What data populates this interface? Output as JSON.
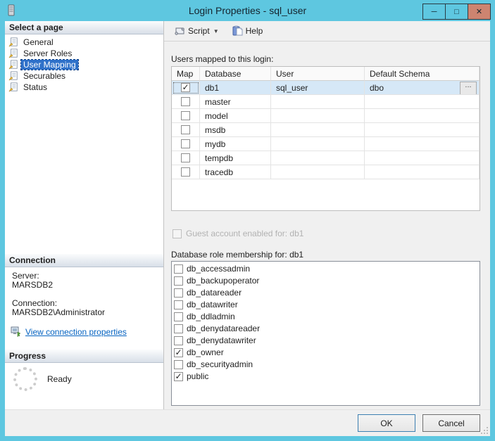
{
  "window": {
    "title": "Login Properties - sql_user",
    "controls": {
      "minimize_glyph": "─",
      "maximize_glyph": "□",
      "close_glyph": "✕"
    }
  },
  "sidebar": {
    "select_page": {
      "header": "Select a page",
      "items": [
        {
          "label": "General",
          "selected": false
        },
        {
          "label": "Server Roles",
          "selected": false
        },
        {
          "label": "User Mapping",
          "selected": true
        },
        {
          "label": "Securables",
          "selected": false
        },
        {
          "label": "Status",
          "selected": false
        }
      ]
    },
    "connection": {
      "header": "Connection",
      "server_label": "Server:",
      "server_value": "MARSDB2",
      "connection_label": "Connection:",
      "connection_value": "MARSDB2\\Administrator",
      "link_label": "View connection properties"
    },
    "progress": {
      "header": "Progress",
      "status": "Ready"
    }
  },
  "toolbar": {
    "script_label": "Script",
    "help_label": "Help"
  },
  "main": {
    "users_mapped_label": "Users mapped to this login:",
    "table": {
      "columns": [
        "Map",
        "Database",
        "User",
        "Default Schema"
      ],
      "rows": [
        {
          "map": true,
          "database": "db1",
          "user": "sql_user",
          "default_schema": "dbo",
          "selected": true
        },
        {
          "map": false,
          "database": "master",
          "user": "",
          "default_schema": "",
          "selected": false
        },
        {
          "map": false,
          "database": "model",
          "user": "",
          "default_schema": "",
          "selected": false
        },
        {
          "map": false,
          "database": "msdb",
          "user": "",
          "default_schema": "",
          "selected": false
        },
        {
          "map": false,
          "database": "mydb",
          "user": "",
          "default_schema": "",
          "selected": false
        },
        {
          "map": false,
          "database": "tempdb",
          "user": "",
          "default_schema": "",
          "selected": false
        },
        {
          "map": false,
          "database": "tracedb",
          "user": "",
          "default_schema": "",
          "selected": false
        }
      ]
    },
    "guest_label": "Guest account enabled for: db1",
    "guest_checked": false,
    "role_label": "Database role membership for: db1",
    "roles": [
      {
        "name": "db_accessadmin",
        "checked": false
      },
      {
        "name": "db_backupoperator",
        "checked": false
      },
      {
        "name": "db_datareader",
        "checked": false
      },
      {
        "name": "db_datawriter",
        "checked": false
      },
      {
        "name": "db_ddladmin",
        "checked": false
      },
      {
        "name": "db_denydatareader",
        "checked": false
      },
      {
        "name": "db_denydatawriter",
        "checked": false
      },
      {
        "name": "db_owner",
        "checked": true
      },
      {
        "name": "db_securityadmin",
        "checked": false
      },
      {
        "name": "public",
        "checked": true
      }
    ]
  },
  "footer": {
    "ok_label": "OK",
    "cancel_label": "Cancel"
  },
  "icons": {
    "check": "✓",
    "caret_down": "▼",
    "ellipsis": "..."
  },
  "colors": {
    "titlebar": "#5ec7e0",
    "close_button": "#cd8470",
    "selection": "#2f71c9",
    "row_highlight": "#d6e8f7",
    "link": "#0563c1"
  }
}
